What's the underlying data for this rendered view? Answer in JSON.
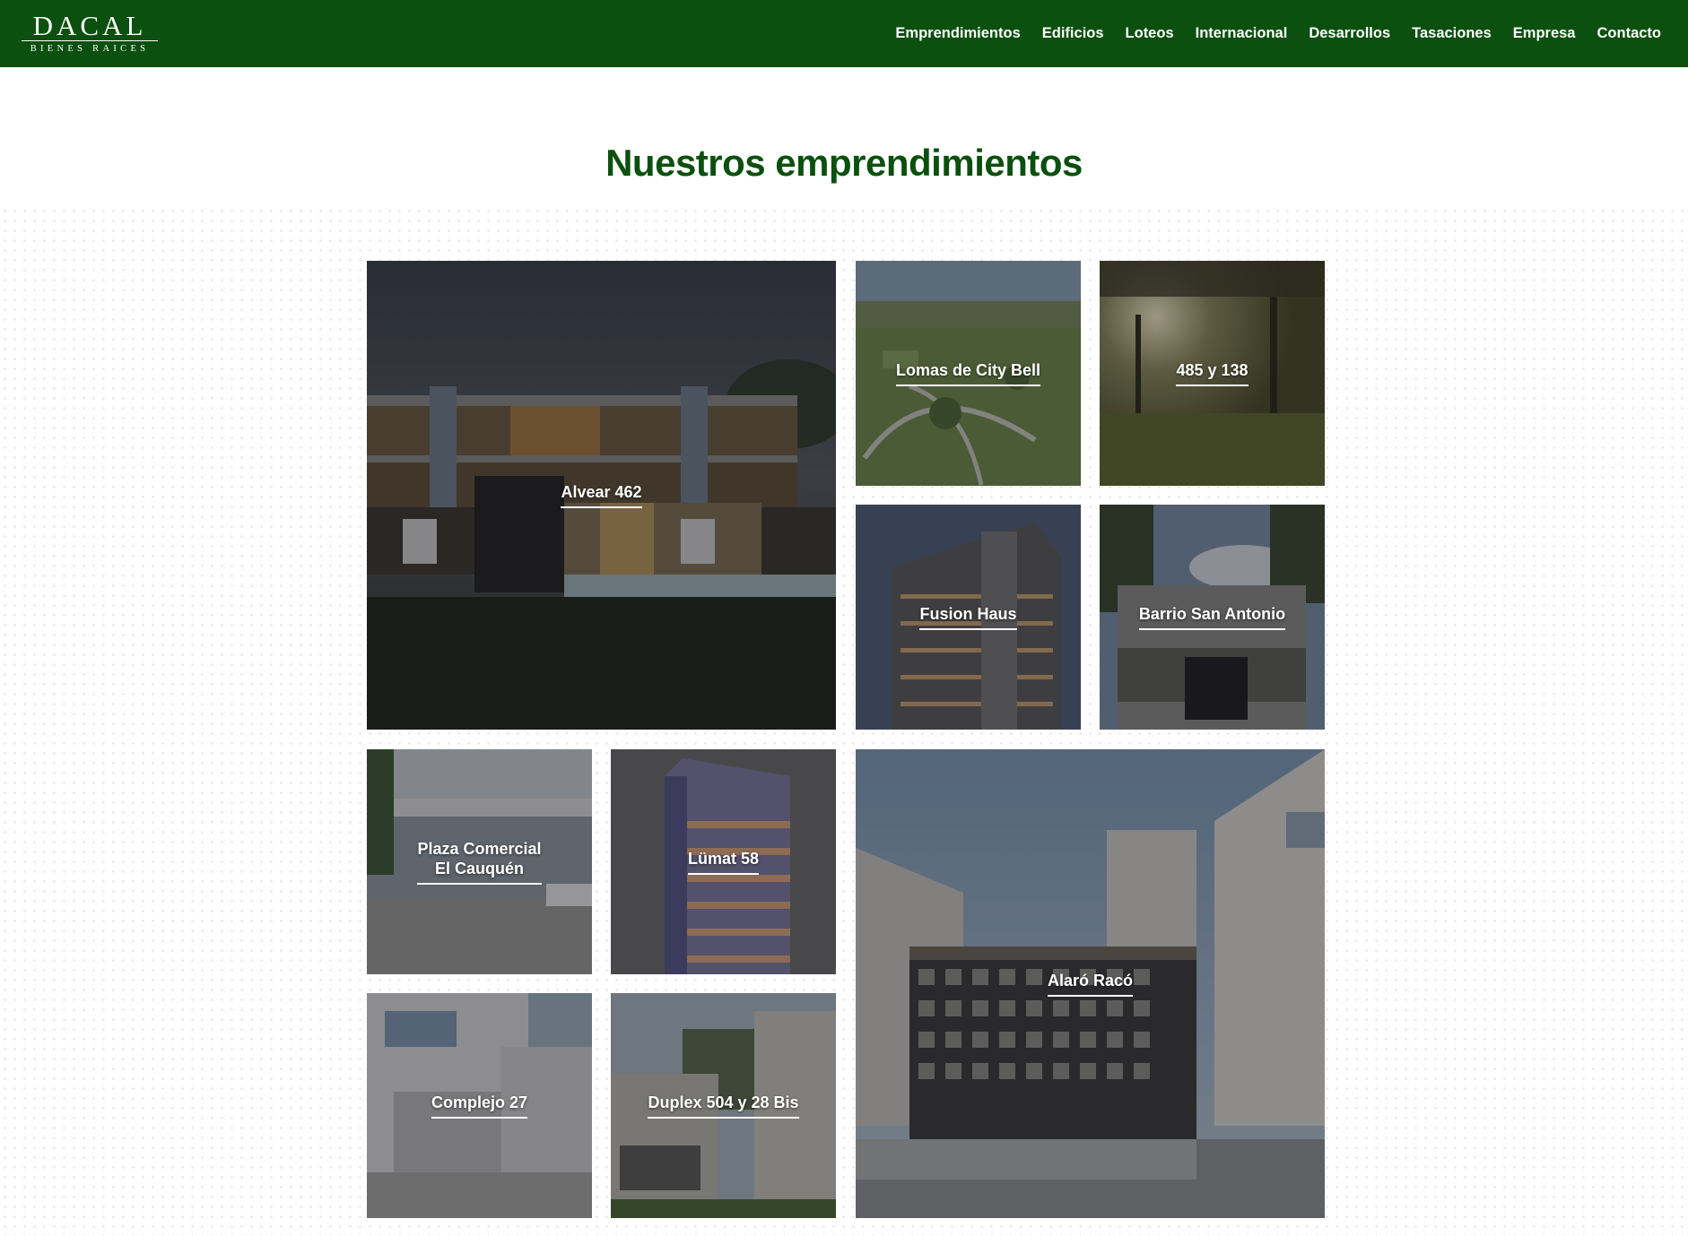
{
  "header": {
    "logo_main": "DACAL",
    "logo_sub": "BIENES RAICES",
    "bg_color": "#0b500e",
    "nav": [
      "Emprendimientos",
      "Edificios",
      "Loteos",
      "Internacional",
      "Desarrollos",
      "Tasaciones",
      "Empresa",
      "Contacto"
    ]
  },
  "main": {
    "title": "Nuestros emprendimientos",
    "title_color": "#0b500e",
    "projects": [
      {
        "name": "Alvear 462"
      },
      {
        "name": "Lomas de City Bell"
      },
      {
        "name": "485 y 138"
      },
      {
        "name": "Fusion Haus"
      },
      {
        "name": "Barrio San Antonio"
      },
      {
        "name": "Plaza Comercial\nEl Cauquén"
      },
      {
        "name": "Lümat 58"
      },
      {
        "name": "Alaró Racó"
      },
      {
        "name": "Complejo 27"
      },
      {
        "name": "Duplex 504 y 28 Bis"
      }
    ]
  }
}
